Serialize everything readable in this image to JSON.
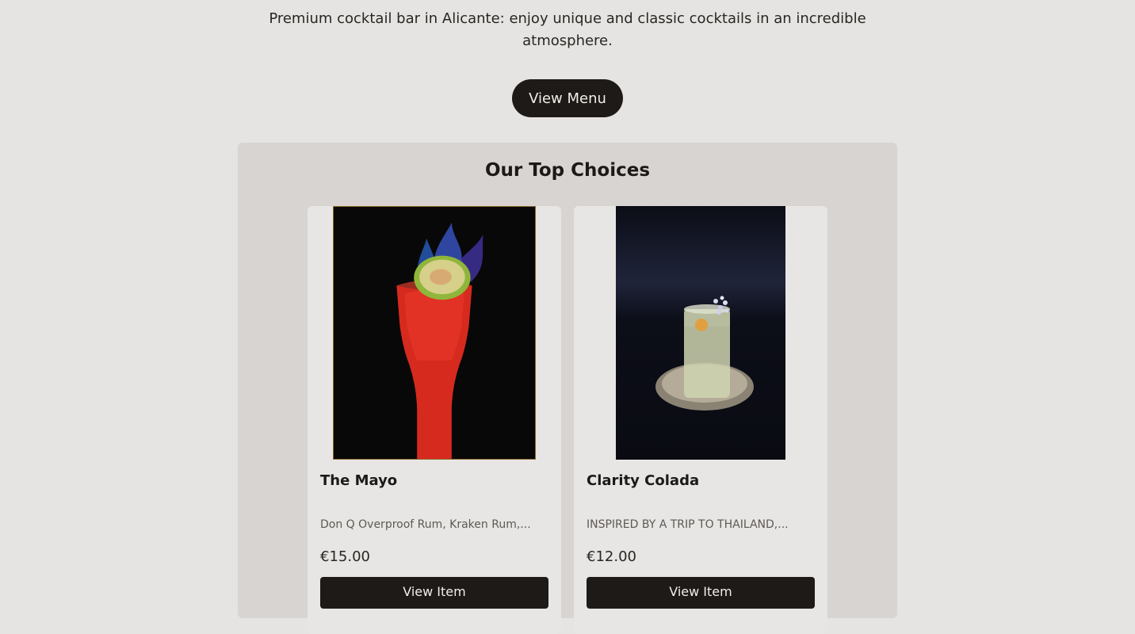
{
  "hero": {
    "tagline": "Premium cocktail bar in Alicante: enjoy unique and classic cocktails in an incredible atmosphere.",
    "menu_button": "View Menu"
  },
  "top_choices": {
    "title": "Our Top Choices",
    "items": [
      {
        "name": "The Mayo",
        "description": "Don Q Overproof Rum, Kraken Rum,...",
        "price": "€15.00",
        "button": "View Item",
        "image": "red-flaming-cocktail-photo"
      },
      {
        "name": "Clarity Colada",
        "description": "INSPIRED BY A TRIP TO THAILAND,...",
        "price": "€12.00",
        "button": "View Item",
        "image": "clear-highball-cocktail-photo"
      }
    ]
  },
  "colors": {
    "page_bg": "#e5e4e2",
    "panel_bg": "#d8d4d1",
    "card_bg": "#e7e6e4",
    "button_bg": "#1d1a17",
    "button_text": "#f1eee9"
  }
}
